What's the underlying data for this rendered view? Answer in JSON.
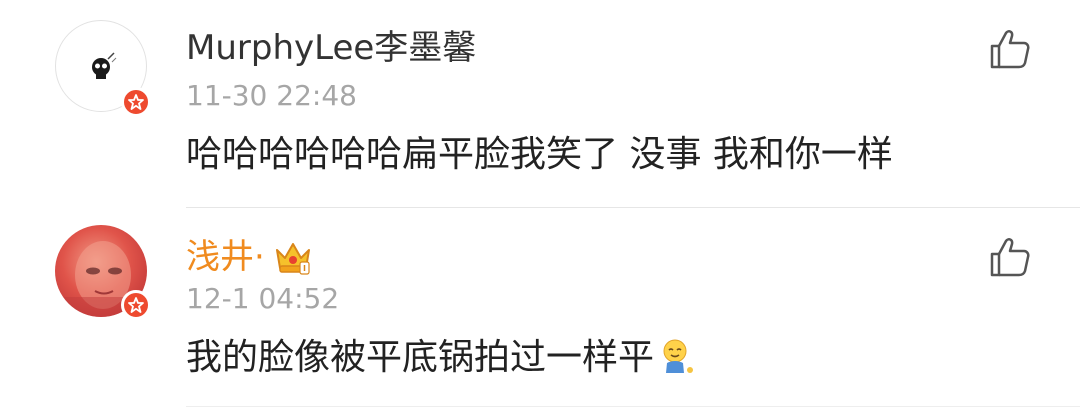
{
  "comments": [
    {
      "username": "MurphyLee李墨馨",
      "time": "11-30 22:48",
      "text": "哈哈哈哈哈哈扁平脸我笑了 没事 我和你一样",
      "avatar_icon": "skull-avatar-icon",
      "badge_icon": "verified-star-icon",
      "like_icon": "thumbs-up-icon"
    },
    {
      "username": "浅井·",
      "time": "12-1 04:52",
      "text": "我的脸像被平底锅拍过一样平",
      "avatar_icon": "photo-avatar-icon",
      "badge_icon": "verified-star-icon",
      "vip_icon": "gold-crown-icon",
      "emoji_icon": "sweat-smile-emoji-icon",
      "like_icon": "thumbs-up-icon"
    }
  ],
  "colors": {
    "username_default": "#333333",
    "username_vip": "#f08b1f",
    "timestamp": "#a6a6a6",
    "badge": "#ee4a2f"
  }
}
